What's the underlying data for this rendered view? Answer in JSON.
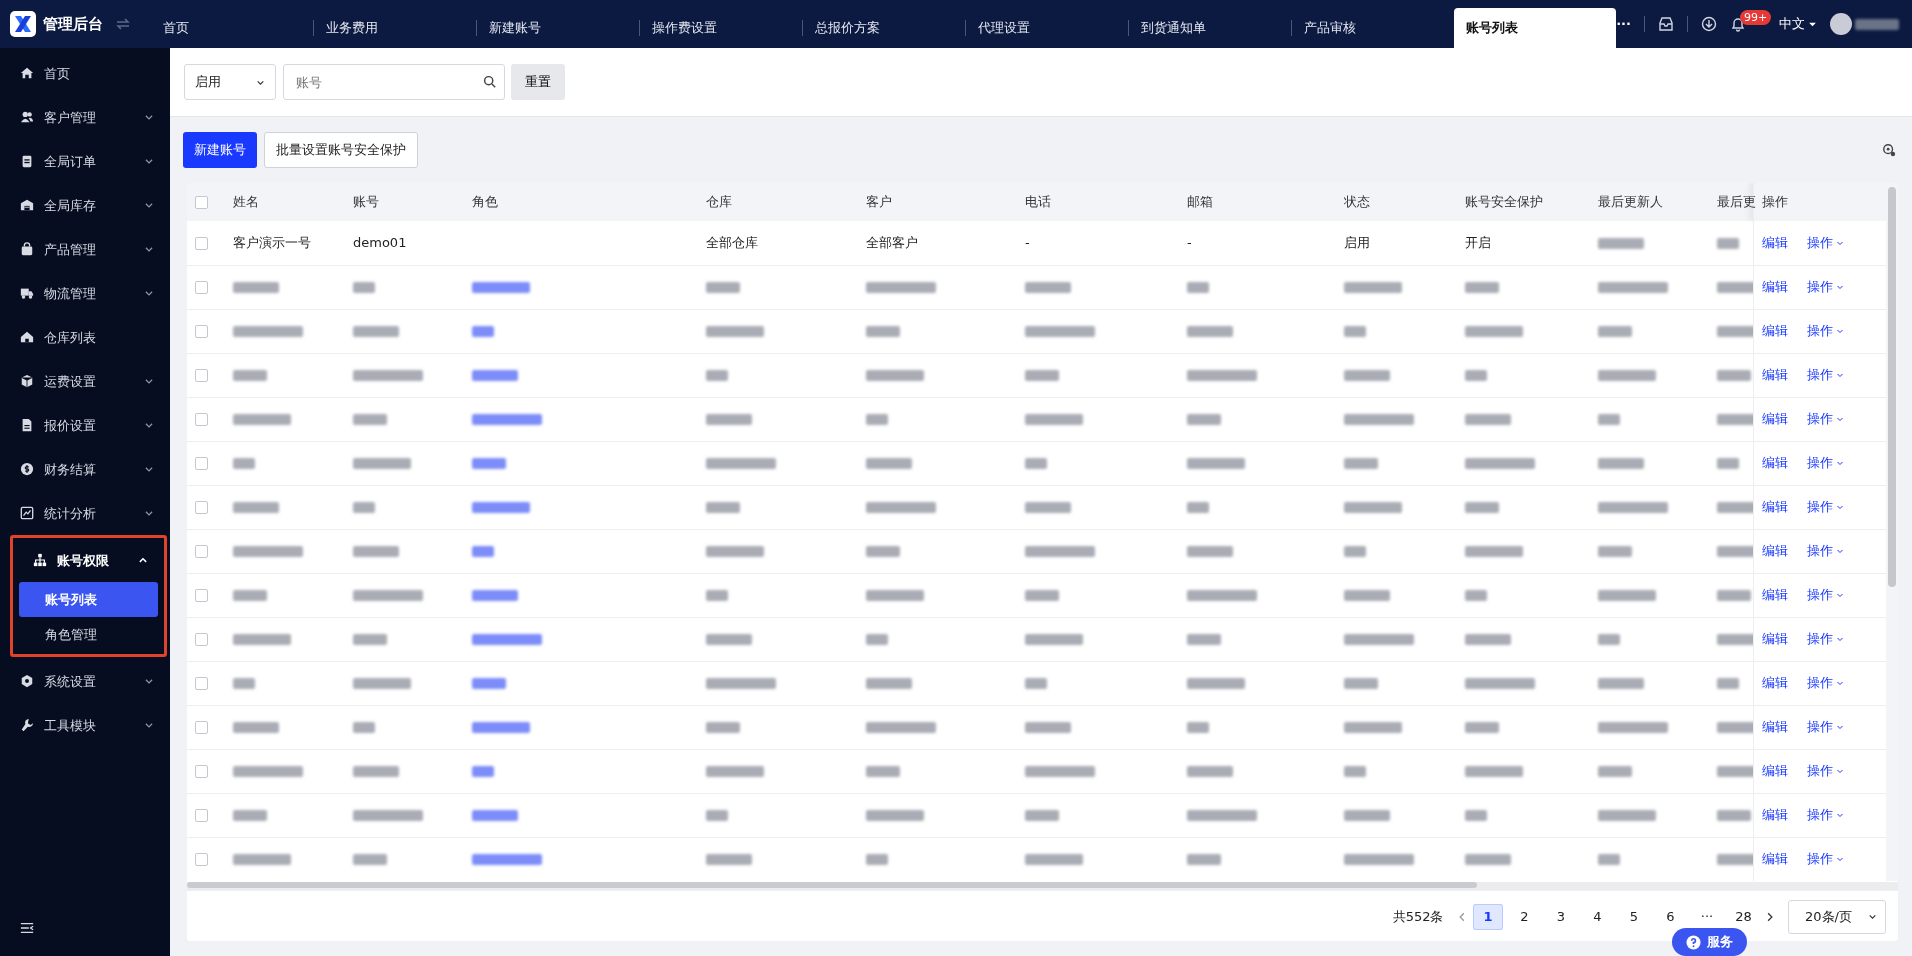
{
  "app": {
    "title": "管理后台"
  },
  "tabs": [
    {
      "label": "首页",
      "selected": false
    },
    {
      "label": "业务费用",
      "selected": false
    },
    {
      "label": "新建账号",
      "selected": false
    },
    {
      "label": "操作费设置",
      "selected": false
    },
    {
      "label": "总报价方案",
      "selected": false
    },
    {
      "label": "代理设置",
      "selected": false
    },
    {
      "label": "到货通知单",
      "selected": false
    },
    {
      "label": "产品审核",
      "selected": false
    },
    {
      "label": "账号列表",
      "selected": true
    }
  ],
  "header": {
    "more": "···",
    "notification_count": "99+",
    "language": "中文"
  },
  "sidebar": {
    "items": [
      {
        "label": "首页",
        "expandable": false,
        "expanded": false,
        "highlighted": false
      },
      {
        "label": "客户管理",
        "expandable": true,
        "expanded": false,
        "highlighted": false
      },
      {
        "label": "全局订单",
        "expandable": true,
        "expanded": false,
        "highlighted": false
      },
      {
        "label": "全局库存",
        "expandable": true,
        "expanded": false,
        "highlighted": false
      },
      {
        "label": "产品管理",
        "expandable": true,
        "expanded": false,
        "highlighted": false
      },
      {
        "label": "物流管理",
        "expandable": true,
        "expanded": false,
        "highlighted": false
      },
      {
        "label": "仓库列表",
        "expandable": false,
        "expanded": false,
        "highlighted": false
      },
      {
        "label": "运费设置",
        "expandable": true,
        "expanded": false,
        "highlighted": false
      },
      {
        "label": "报价设置",
        "expandable": true,
        "expanded": false,
        "highlighted": false
      },
      {
        "label": "财务结算",
        "expandable": true,
        "expanded": false,
        "highlighted": false
      },
      {
        "label": "统计分析",
        "expandable": true,
        "expanded": false,
        "highlighted": false
      },
      {
        "label": "账号权限",
        "expandable": true,
        "expanded": true,
        "highlighted": true,
        "children": [
          {
            "label": "账号列表",
            "selected": true
          },
          {
            "label": "角色管理",
            "selected": false
          }
        ]
      },
      {
        "label": "系统设置",
        "expandable": true,
        "expanded": false,
        "highlighted": false
      },
      {
        "label": "工具模块",
        "expandable": true,
        "expanded": false,
        "highlighted": false
      }
    ]
  },
  "filters": {
    "status": "启用",
    "search": {
      "placeholder": "账号"
    },
    "reset": "重置"
  },
  "toolbar": {
    "buttons": [
      {
        "label": "新建账号",
        "kind": "primary"
      },
      {
        "label": "批量设置账号安全保护",
        "kind": "outline"
      }
    ]
  },
  "table": {
    "select_all_checked": false,
    "columns": [
      "姓名",
      "账号",
      "角色",
      "仓库",
      "客户",
      "电话",
      "邮箱",
      "状态",
      "账号安全保护",
      "最后更新人",
      "最后更",
      "操作"
    ],
    "rows": [
      {
        "checked": false,
        "blurred": false,
        "cells": [
          {
            "text": "客户演示一号"
          },
          {
            "text": "demo01"
          },
          {},
          {
            "text": "全部仓库"
          },
          {
            "text": "全部客户"
          },
          {
            "text": "-"
          },
          {
            "text": "-"
          },
          {
            "text": "启用"
          },
          {
            "text": "开启"
          },
          {
            "blurred": true
          },
          {
            "blurred": true
          }
        ],
        "edit": "编辑",
        "more": "操作"
      },
      {
        "checked": false,
        "blurred": true,
        "edit": "编辑",
        "more": "操作"
      },
      {
        "checked": false,
        "blurred": true,
        "edit": "编辑",
        "more": "操作"
      },
      {
        "checked": false,
        "blurred": true,
        "edit": "编辑",
        "more": "操作"
      },
      {
        "checked": false,
        "blurred": true,
        "edit": "编辑",
        "more": "操作"
      },
      {
        "checked": false,
        "blurred": true,
        "edit": "编辑",
        "more": "操作"
      },
      {
        "checked": false,
        "blurred": true,
        "edit": "编辑",
        "more": "操作"
      },
      {
        "checked": false,
        "blurred": true,
        "edit": "编辑",
        "more": "操作"
      },
      {
        "checked": false,
        "blurred": true,
        "edit": "编辑",
        "more": "操作"
      },
      {
        "checked": false,
        "blurred": true,
        "edit": "编辑",
        "more": "操作"
      },
      {
        "checked": false,
        "blurred": true,
        "edit": "编辑",
        "more": "操作"
      },
      {
        "checked": false,
        "blurred": true,
        "edit": "编辑",
        "more": "操作"
      },
      {
        "checked": false,
        "blurred": true,
        "edit": "编辑",
        "more": "操作"
      },
      {
        "checked": false,
        "blurred": true,
        "edit": "编辑",
        "more": "操作"
      },
      {
        "checked": false,
        "blurred": true,
        "edit": "编辑",
        "more": "操作"
      }
    ]
  },
  "pagination": {
    "total": "共552条",
    "pages": [
      {
        "label": "1",
        "kind": "page",
        "selected": true
      },
      {
        "label": "2",
        "kind": "page",
        "selected": false
      },
      {
        "label": "3",
        "kind": "page",
        "selected": false
      },
      {
        "label": "4",
        "kind": "page",
        "selected": false
      },
      {
        "label": "5",
        "kind": "page",
        "selected": false
      },
      {
        "label": "6",
        "kind": "page",
        "selected": false
      },
      {
        "label": "···",
        "kind": "ellipsis"
      },
      {
        "label": "28",
        "kind": "page",
        "selected": false
      }
    ],
    "page_size": "20条/页"
  },
  "service_button": "服务"
}
